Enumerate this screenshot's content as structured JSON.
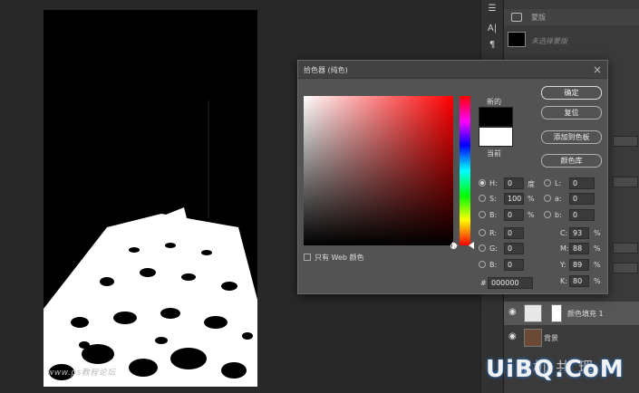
{
  "canvas": {
    "watermark": "www.ps教程论坛"
  },
  "panel": {
    "mask_label": "蒙版",
    "props_label": "未选择蒙版",
    "layers": [
      {
        "name": "颜色填充 1"
      },
      {
        "name": "背景"
      }
    ]
  },
  "dialog": {
    "title": "拾色器 (纯色)",
    "close": "×",
    "new_label": "新的",
    "current_label": "当前",
    "buttons": {
      "ok": "确定",
      "reset": "复位",
      "add_swatch": "添加到色板",
      "color_library": "颜色库"
    },
    "only_web": "只有 Web 颜色",
    "hsb": {
      "h_label": "H:",
      "h": "0",
      "h_unit": "度",
      "s_label": "S:",
      "s": "100",
      "s_unit": "%",
      "b_label": "B:",
      "b": "0",
      "b_unit": "%"
    },
    "rgb": {
      "r_label": "R:",
      "r": "0",
      "g_label": "G:",
      "g": "0",
      "b_label": "B:",
      "b": "0"
    },
    "lab": {
      "l_label": "L:",
      "l": "0",
      "a_label": "a:",
      "a": "0",
      "b_label": "b:",
      "b": "0"
    },
    "cmyk": {
      "c_label": "C:",
      "c": "93",
      "m_label": "M:",
      "m": "88",
      "y_label": "Y:",
      "y": "89",
      "k_label": "K:",
      "k": "80",
      "unit": "%"
    },
    "hex_label": "#",
    "hex": "000000"
  },
  "site": {
    "logo": "UiBQ.CoM",
    "under": "原机  共 理"
  },
  "colors": {
    "hue_selected": "#ff0000",
    "new_color": "#000000",
    "current_color": "#ffffff"
  }
}
